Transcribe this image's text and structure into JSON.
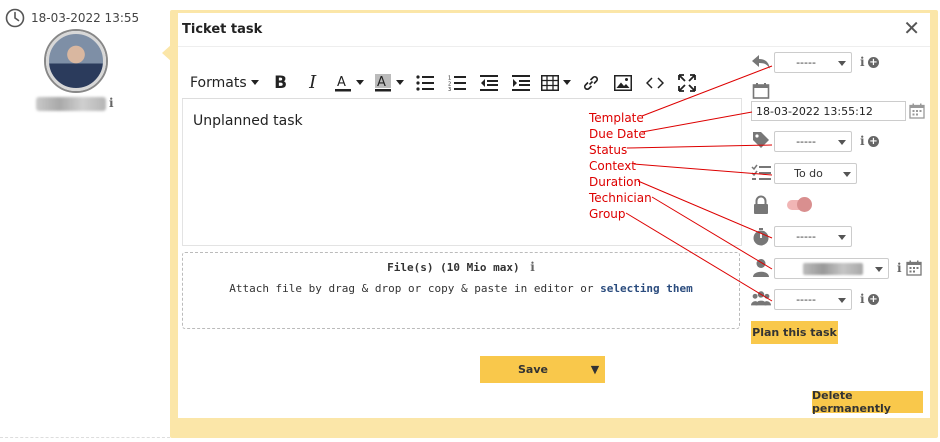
{
  "timeline": {
    "timestamp": "18-03-2022 13:55",
    "author_info": "i"
  },
  "panel": {
    "title": "Ticket task",
    "close_glyph": "✕"
  },
  "toolbar": {
    "formats_label": "Formats",
    "bold_label": "B",
    "italic_label": "I",
    "icons": [
      "font-color-icon",
      "background-color-icon",
      "bullet-list-icon",
      "numbered-list-icon",
      "outdent-icon",
      "indent-icon",
      "table-icon",
      "link-icon",
      "image-icon",
      "code-icon",
      "fullscreen-icon"
    ]
  },
  "editor": {
    "content": "Unplanned task"
  },
  "files": {
    "title": "File(s) (10 Mio max)",
    "info": "i",
    "hint": "Attach file by drag & drop or copy & paste in editor or ",
    "link": "selecting them"
  },
  "save": {
    "label": "Save",
    "arrow": "▼"
  },
  "side": {
    "template_value": "-----",
    "due_date_value": "18-03-2022 13:55:12",
    "status_value": "-----",
    "context_value": "To do",
    "duration_value": "-----",
    "technician_value": "",
    "group_value": "-----",
    "info_glyph": "i",
    "plus_glyph": "+",
    "plan_label": "Plan this task",
    "delete_label": "Delete permanently"
  },
  "annotations": {
    "color": "#d00000",
    "labels": [
      "Template",
      "Due Date",
      "Status",
      "Context",
      "Duration",
      "Technician",
      "Group"
    ]
  },
  "colors": {
    "accent": "#f9c84b",
    "panel_border": "#fbe6a8",
    "link": "#2b4c7e"
  }
}
